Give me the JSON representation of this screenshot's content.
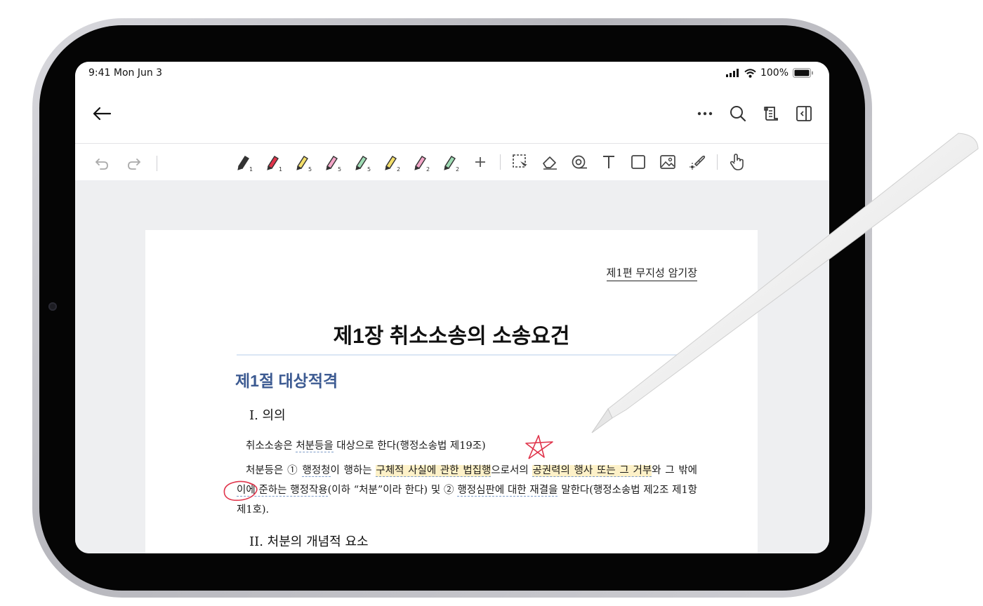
{
  "status": {
    "time": "9:41  Mon Jun 3",
    "battery": "100%"
  },
  "nav": {
    "back_icon": "arrow-left-icon",
    "icons": [
      "more-icon",
      "search-icon",
      "scroll-icon",
      "sidebar-icon"
    ]
  },
  "toolbar": {
    "undo_icon": "undo-icon",
    "redo_icon": "redo-icon",
    "pens": [
      {
        "name": "pen-black",
        "color": "#333333",
        "size": "1"
      },
      {
        "name": "pen-red",
        "color": "#e0344b",
        "size": "1"
      },
      {
        "name": "highlighter-yellow",
        "color": "#f4df6a",
        "size": "5"
      },
      {
        "name": "highlighter-pink",
        "color": "#f3a6c8",
        "size": "5"
      },
      {
        "name": "highlighter-green",
        "color": "#9fdcb5",
        "size": "5"
      },
      {
        "name": "highlighter-yellow-2",
        "color": "#f4df6a",
        "size": "2"
      },
      {
        "name": "highlighter-pink-2",
        "color": "#f3a6c8",
        "size": "2"
      },
      {
        "name": "highlighter-green-2",
        "color": "#9fdcb5",
        "size": "2"
      }
    ],
    "tools": [
      "add-icon",
      "lasso-select-icon",
      "eraser-icon",
      "tape-icon",
      "text-icon",
      "shape-icon",
      "image-icon",
      "laser-pointer-icon",
      "hand-icon"
    ]
  },
  "document": {
    "header_right": "제1편 무지성 암기장",
    "chapter_title": "제1장 취소소송의  소송요건",
    "section_title": "제1절 대상적격",
    "sub1": "I. 의의",
    "p1": {
      "a": "취소소송은 ",
      "b": "처분등을",
      "c": " 대상으로 한다(행정소송법 제19조)"
    },
    "p2": {
      "t1": "처분등은 ① ",
      "u1": "행정청",
      "t2": "이 행하는 ",
      "h1": "구체적 사실에 관한 법집행",
      "t3": "으로서의 ",
      "h2": "공권력의 행사 또는 그 거부",
      "t4": "와 그 밖에 ",
      "u2": "이에 준하는 행정작용",
      "t5": "(이하 “처분”이라 한다) 및 ② ",
      "u3": "행정심판에 대한 재결을",
      "t6": " 말한다(행정소송법 제2조 제1항 제1호)."
    },
    "sub2": "II. 처분의 개념적 요소"
  },
  "annotation_color": "#e0344b"
}
